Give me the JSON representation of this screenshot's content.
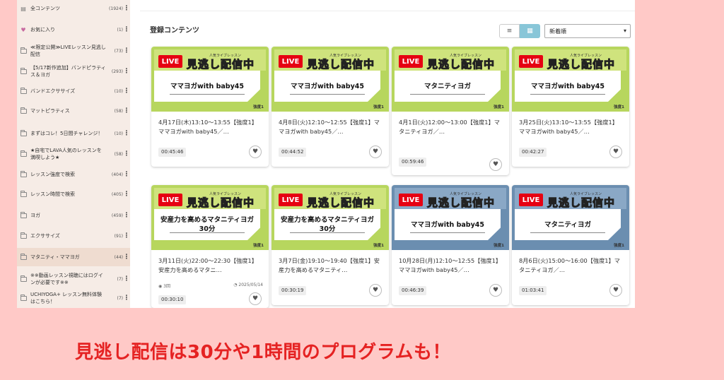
{
  "sidebar": {
    "items": [
      {
        "label": "全コンテンツ",
        "count": "(1924)",
        "icon": "film-icon"
      },
      {
        "label": "お気に入り",
        "count": "(1)",
        "icon": "heart-icon"
      },
      {
        "label": "≪限定公開≫LIVEレッスン見逃し配信",
        "count": "(73)",
        "icon": "folder-icon"
      },
      {
        "label": "【5/17新作追加】バンドピラティス＆ヨガ",
        "count": "(293)",
        "icon": "folder-icon"
      },
      {
        "label": "バンドエクササイズ",
        "count": "(10)",
        "icon": "folder-icon"
      },
      {
        "label": "マットピラティス",
        "count": "(58)",
        "icon": "folder-icon"
      },
      {
        "label": "まずはコレ！5日間チャレンジ！",
        "count": "(10)",
        "icon": "folder-icon"
      },
      {
        "label": "★自宅でLAVA人気のレッスンを満喫しよう★",
        "count": "(58)",
        "icon": "folder-icon"
      },
      {
        "label": "レッスン強度で検索",
        "count": "(404)",
        "icon": "folder-icon"
      },
      {
        "label": "レッスン時間で検索",
        "count": "(405)",
        "icon": "folder-icon"
      },
      {
        "label": "ヨガ",
        "count": "(459)",
        "icon": "folder-icon"
      },
      {
        "label": "エクササイズ",
        "count": "(91)",
        "icon": "folder-icon"
      },
      {
        "label": "マタニティ・ママヨガ",
        "count": "(44)",
        "icon": "folder-icon"
      },
      {
        "label": "※※動画レッスン視聴にはログインが必要です※※",
        "count": "(7)",
        "icon": "folder-icon"
      },
      {
        "label": "UCHIYOGA+ レッスン無料体験はこちら！",
        "count": "(7)",
        "icon": "folder-icon"
      }
    ],
    "menu_glyph": "⋮"
  },
  "main": {
    "section_title": "登録コンテンツ",
    "sort_value": "新着順",
    "view_list_glyph": "≡",
    "view_grid_glyph": "▦"
  },
  "cards": [
    {
      "banner_live": "LIVE",
      "banner_small": "人気ライブレッスン",
      "banner_big": "見逃し配信中",
      "panel": "ママヨガwith baby45",
      "intensity": "強度1",
      "title": "4月17日(木)13:10～13:55【強度1】ママヨガwith baby45／…",
      "duration": "00:45:46",
      "views": "",
      "date": "",
      "color": "green"
    },
    {
      "banner_live": "LIVE",
      "banner_small": "人気ライブレッスン",
      "banner_big": "見逃し配信中",
      "panel": "ママヨガwith baby45",
      "intensity": "強度1",
      "title": "4月8日(火)12:10～12:55【強度1】ママヨガwith baby45／…",
      "duration": "00:44:52",
      "views": "",
      "date": "",
      "color": "green"
    },
    {
      "banner_live": "LIVE",
      "banner_small": "人気ライブレッスン",
      "banner_big": "見逃し配信中",
      "panel": "マタニティヨガ",
      "intensity": "強度1",
      "title": "4月1日(火)12:00～13:00【強度1】マタニティヨガ／…",
      "duration": "00:59:46",
      "views": "",
      "date": "",
      "color": "green"
    },
    {
      "banner_live": "LIVE",
      "banner_small": "人気ライブレッスン",
      "banner_big": "見逃し配信中",
      "panel": "ママヨガwith baby45",
      "intensity": "強度1",
      "title": "3月25日(火)13:10～13:55【強度1】ママヨガwith baby45／…",
      "duration": "00:42:27",
      "views": "",
      "date": "",
      "color": "green"
    },
    {
      "banner_live": "LIVE",
      "banner_small": "人気ライブレッスン",
      "banner_big": "見逃し配信中",
      "panel": "安産力を高めるマタニティヨガ30分",
      "intensity": "強度1",
      "title": "3月11日(火)22:00～22:30【強度1】安産力を高めるマタニ…",
      "duration": "00:30:10",
      "views": "3回",
      "date": "2025/05/14",
      "color": "green"
    },
    {
      "banner_live": "LIVE",
      "banner_small": "人気ライブレッスン",
      "banner_big": "見逃し配信中",
      "panel": "安産力を高めるマタニティヨガ30分",
      "intensity": "強度1",
      "title": "3月7日(金)19:10～19:40【強度1】安産力を高めるマタニティ…",
      "duration": "00:30:19",
      "views": "",
      "date": "",
      "color": "green"
    },
    {
      "banner_live": "LIVE",
      "banner_small": "人気ライブレッスン",
      "banner_big": "見逃し配信中",
      "panel": "ママヨガwith baby45",
      "intensity": "強度1",
      "title": "10月28日(月)12:10～12:55【強度1】ママヨガwith baby45／…",
      "duration": "00:46:39",
      "views": "",
      "date": "",
      "color": "blue"
    },
    {
      "banner_live": "LIVE",
      "banner_small": "人気ライブレッスン",
      "banner_big": "見逃し配信中",
      "panel": "マタニティヨガ",
      "intensity": "強度1",
      "title": "8月6日(火)15:00～16:00【強度1】マタニティヨガ／…",
      "duration": "01:03:41",
      "views": "",
      "date": "",
      "color": "blue"
    }
  ],
  "headline": "見逃し配信は30分や1時間のプログラムも！",
  "colors": {
    "background": "#ffc9c7",
    "headline": "#e52222",
    "live_red": "#e60012",
    "thumb_green": "#b7d65e",
    "thumb_blue": "#6b8eb0",
    "grid_active": "#88c6d8"
  }
}
